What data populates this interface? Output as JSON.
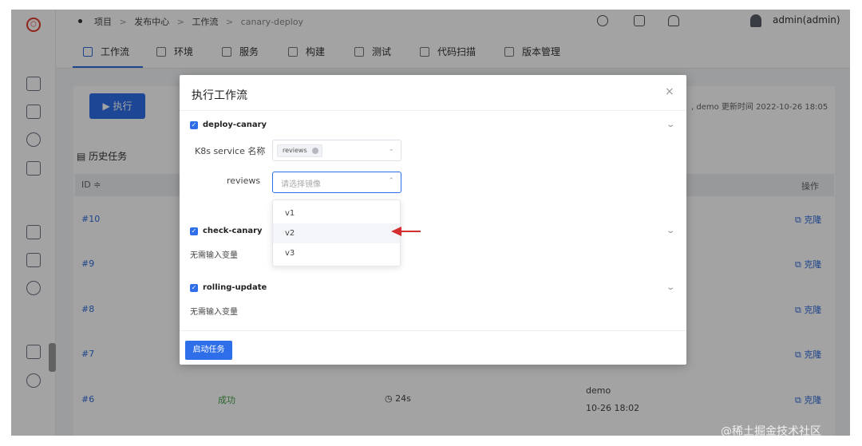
{
  "breadcrumb": [
    "项目",
    ">",
    "发布中心",
    ">",
    "工作流",
    ">",
    "canary-deploy"
  ],
  "user": {
    "name": "admin(admin)"
  },
  "tabs": [
    {
      "label": "工作流",
      "icon": "workflow-icon",
      "active": true
    },
    {
      "label": "环境",
      "icon": "environment-icon"
    },
    {
      "label": "服务",
      "icon": "service-icon"
    },
    {
      "label": "构建",
      "icon": "build-icon"
    },
    {
      "label": "测试",
      "icon": "test-icon"
    },
    {
      "label": "代码扫描",
      "icon": "code-scan-icon"
    },
    {
      "label": "版本管理",
      "icon": "version-icon"
    }
  ],
  "page": {
    "run_button": "执行",
    "history_title": "历史任务",
    "meta": ", demo   更新时间 2022-10-26 18:05",
    "table": {
      "col_id": "ID ≑",
      "col_op": "操作",
      "rows": [
        {
          "id": "#10",
          "action": "克隆"
        },
        {
          "id": "#9",
          "action": "克隆"
        },
        {
          "id": "#8",
          "action": "克隆"
        },
        {
          "id": "#7",
          "action": "克隆"
        },
        {
          "id": "#6",
          "action": "克隆",
          "status": "成功",
          "duration": "24s",
          "user": "demo",
          "time": "10-26 18:02"
        }
      ]
    }
  },
  "modal": {
    "title": "执行工作流",
    "close": "×",
    "jobs": [
      {
        "name": "deploy-canary",
        "k8s_label": "K8s service 名称",
        "k8s_tag": "reviews",
        "image_label": "reviews",
        "image_placeholder": "请选择镜像"
      },
      {
        "name": "check-canary",
        "note": "无需输入变量"
      },
      {
        "name": "rolling-update",
        "note": "无需输入变量"
      }
    ],
    "dropdown_options": [
      "v1",
      "v2",
      "v3"
    ],
    "start_button": "启动任务"
  },
  "annotation_color": "#d32f2f",
  "accent_color": "#2e6ee8",
  "watermark": "@稀土掘金技术社区"
}
